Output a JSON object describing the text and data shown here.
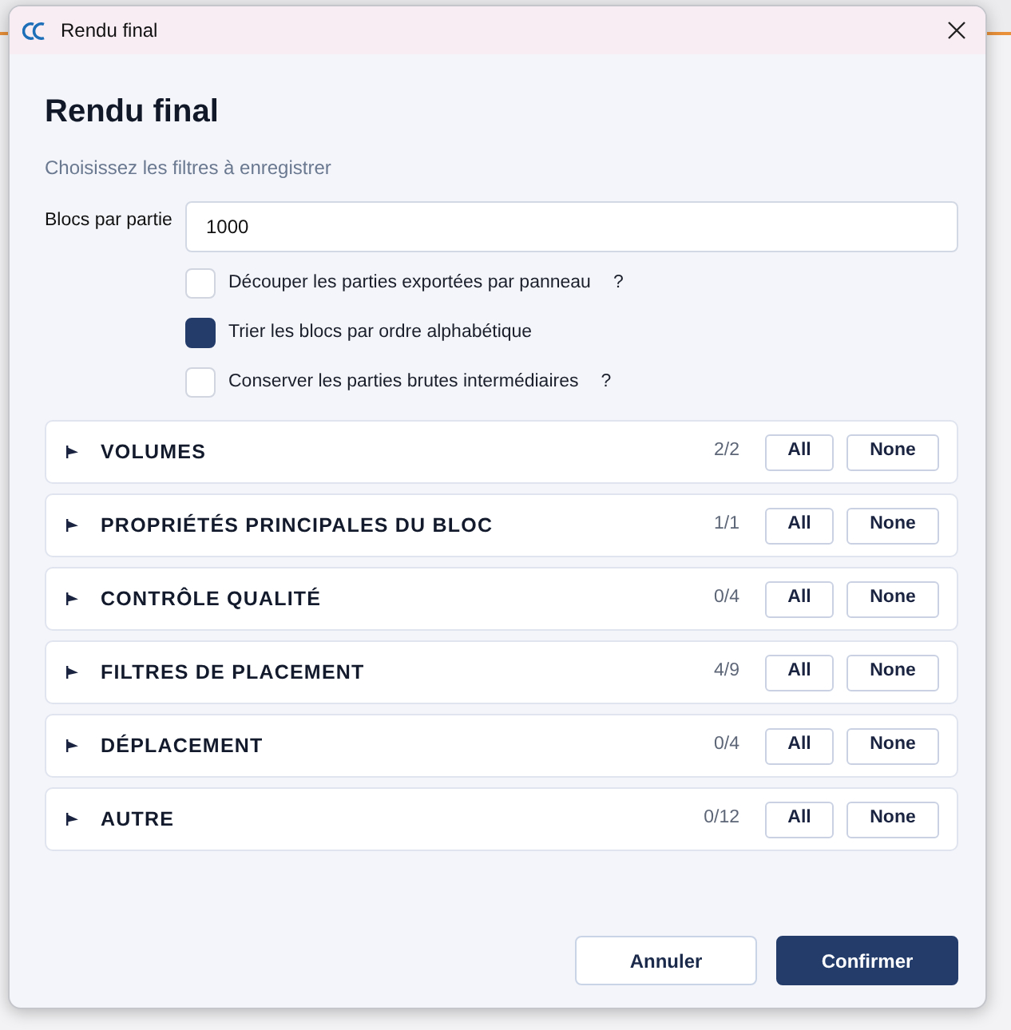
{
  "window": {
    "title": "Rendu final"
  },
  "heading": "Rendu final",
  "subtitle": "Choisissez les filtres à enregistrer",
  "blocks_per_part": {
    "label": "Blocs par partie",
    "value": "1000"
  },
  "options": [
    {
      "label": "Découper les parties exportées par panneau",
      "checked": false,
      "help": "?"
    },
    {
      "label": "Trier les blocs par ordre alphabétique",
      "checked": true
    },
    {
      "label": "Conserver les parties brutes intermédiaires",
      "checked": false,
      "help": "?"
    }
  ],
  "sections": [
    {
      "label": "VOLUMES",
      "count": "2/2",
      "expanded": false,
      "all": "All",
      "none": "None"
    },
    {
      "label": "PROPRIÉTÉS PRINCIPALES DU BLOC",
      "count": "1/1",
      "expanded": false,
      "all": "All",
      "none": "None"
    },
    {
      "label": "CONTRÔLE QUALITÉ",
      "count": "0/4",
      "expanded": false,
      "all": "All",
      "none": "None"
    },
    {
      "label": "FILTRES DE PLACEMENT",
      "count": "4/9",
      "expanded": false,
      "all": "All",
      "none": "None"
    },
    {
      "label": "DÉPLACEMENT",
      "count": "0/4",
      "expanded": false,
      "all": "All",
      "none": "None"
    },
    {
      "label": "AUTRE",
      "count": "0/12",
      "expanded": false,
      "all": "All",
      "none": "None"
    }
  ],
  "footer": {
    "buttons": [
      {
        "label": "Annuler",
        "kind": "secondary"
      },
      {
        "label": "Confirmer",
        "kind": "primary"
      }
    ]
  }
}
